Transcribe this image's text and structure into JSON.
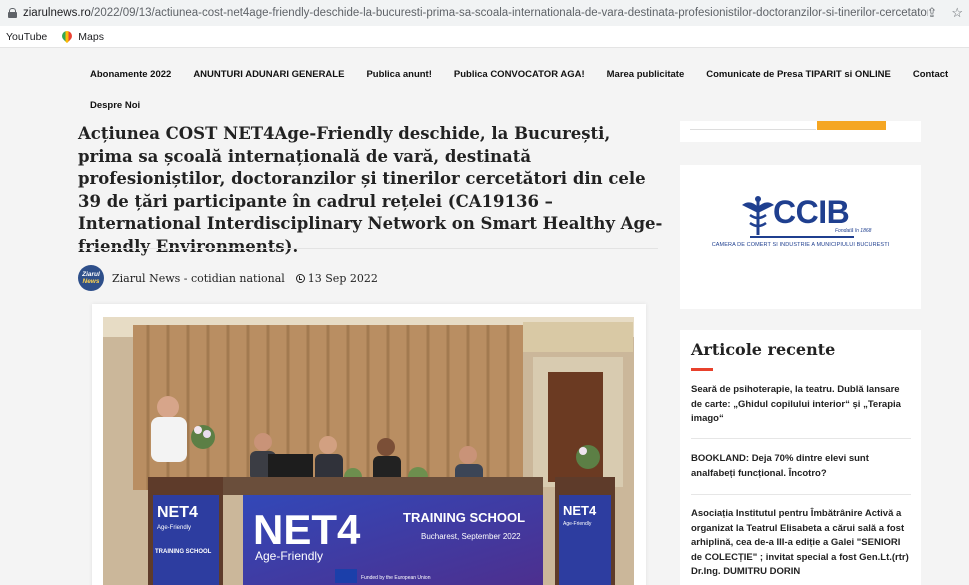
{
  "browser": {
    "url_domain": "ziarulnews.ro",
    "url_path": "/2022/09/13/actiunea-cost-net4age-friendly-deschide-la-bucuresti-prima-sa-scoala-internationala-de-vara-destinata-profesionistilor-doctoranzilor-si-tinerilor-cercetatori-din-...",
    "bookmarks": [
      "YouTube",
      "Maps"
    ]
  },
  "nav": {
    "items": [
      "Abonamente 2022",
      "ANUNTURI ADUNARI GENERALE",
      "Publica anunt!",
      "Publica CONVOCATOR AGA!",
      "Marea publicitate",
      "Comunicate de Presa TIPARIT si ONLINE",
      "Contact"
    ],
    "second_row": "Despre Noi"
  },
  "article": {
    "title": "Acțiunea COST NET4Age-Friendly deschide, la București, prima sa școală internațională de vară, destinată profesioniștilor, doctoranzilor și tinerilor cercetători din cele 39 de țări participante în cadrul rețelei (CA19136 – International Interdisciplinary Network on Smart Healthy Age-friendly Environments).",
    "avatar_line1": "Ziarul",
    "avatar_line2": "News",
    "author": "Ziarul News - cotidian national",
    "date": "13 Sep 2022",
    "photo": {
      "banner_main": "NET4",
      "banner_sub": "Age-Friendly",
      "banner_title": "TRAINING SCHOOL",
      "banner_place": "Bucharest, September 2022",
      "banner_funded": "Funded by the European Union",
      "podium_left": "NET4",
      "podium_left_sub": "Age-Friendly",
      "podium_left_ts": "TRAINING SCHOOL",
      "podium_right": "NET4",
      "podium_right_sub": "Age-Friendly"
    }
  },
  "sidebar": {
    "ccib_logo": "CCIB",
    "ccib_founded": "Fondată în 1868",
    "ccib_caption": "CAMERA DE COMERT SI INDUSTRIE A MUNICIPIULUI BUCURESTI",
    "recent_heading": "Articole recente",
    "recent_items": [
      "Seară de psihoterapie, la teatru. Dublă lansare de carte: „Ghidul copilului interior“ și „Terapia imago“",
      "BOOKLAND: Deja 70% dintre elevi sunt analfabeți funcțional. Încotro?",
      "Asociația Institutul pentru Îmbătrânire Activă a organizat la Teatrul Elisabeta a cărui sală a fost arhiplină, cea de-a III-a ediție a Galei \"SENIORI de COLECȚIE\" ; invitat special a fost Gen.Lt.(rtr) Dr.Ing. DUMITRU DORIN"
    ]
  },
  "colors": {
    "accent": "#e8412c",
    "ccib_blue": "#1f3f8f",
    "search_button": "#f5a623"
  }
}
